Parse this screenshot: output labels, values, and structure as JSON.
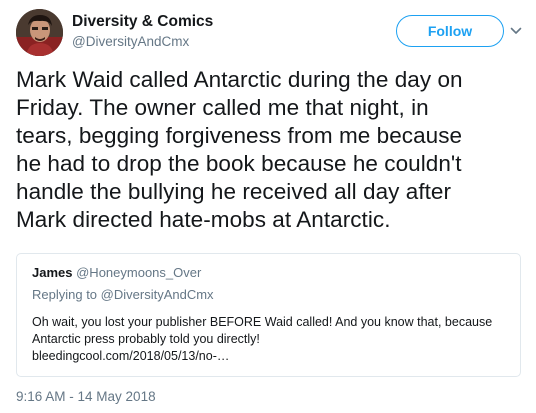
{
  "author": {
    "display_name": "Diversity & Comics",
    "handle": "@DiversityAndCmx",
    "avatar_icon": "profile-photo"
  },
  "actions": {
    "follow_label": "Follow",
    "more_icon": "chevron-down-icon"
  },
  "tweet": {
    "lines": [
      "Mark Waid called Antarctic during the day on",
      "Friday. The owner called me that night, in",
      "tears, begging forgiveness from me because",
      "he had to drop the book because he couldn't",
      "handle the bullying he received all day after",
      "Mark directed hate-mobs at Antarctic."
    ]
  },
  "quote": {
    "name": "James",
    "handle": "@Honeymoons_Over",
    "replying_prefix": "Replying to",
    "replying_to": "@DiversityAndCmx",
    "lines": [
      "Oh wait, you lost your publisher BEFORE Waid called! And you know that, because",
      "Antarctic press probably told you directly!",
      "bleedingcool.com/2018/05/13/no-…"
    ]
  },
  "timestamp": "9:16 AM - 14 May 2018",
  "colors": {
    "accent": "#1da1f2",
    "muted": "#657786",
    "text": "#14171a",
    "border": "#e1e8ed"
  }
}
